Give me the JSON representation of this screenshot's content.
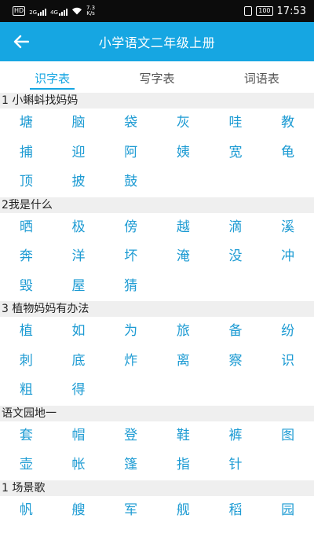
{
  "status_bar": {
    "hd_label": "HD",
    "sig1_label": "2G",
    "sig2_label": "4G",
    "net_speed_value": "7.3",
    "net_speed_unit": "K/s",
    "battery": "100",
    "time": "17:53"
  },
  "app_bar": {
    "title": "小学语文二年级上册",
    "back_icon": "arrow-left-icon"
  },
  "tabs": [
    {
      "label": "识字表",
      "active": true
    },
    {
      "label": "写字表",
      "active": false
    },
    {
      "label": "词语表",
      "active": false
    }
  ],
  "colors": {
    "accent": "#16a6e2",
    "char_text": "#1d9bd3",
    "section_bg": "#efefef"
  },
  "sections": [
    {
      "title": "1 小蝌蚪找妈妈",
      "chars": [
        "塘",
        "脑",
        "袋",
        "灰",
        "哇",
        "教",
        "捕",
        "迎",
        "阿",
        "姨",
        "宽",
        "龟",
        "顶",
        "披",
        "鼓"
      ]
    },
    {
      "title": "2我是什么",
      "chars": [
        "晒",
        "极",
        "傍",
        "越",
        "滴",
        "溪",
        "奔",
        "洋",
        "坏",
        "淹",
        "没",
        "冲",
        "毁",
        "屋",
        "猜"
      ]
    },
    {
      "title": "3 植物妈妈有办法",
      "chars": [
        "植",
        "如",
        "为",
        "旅",
        "备",
        "纷",
        "刺",
        "底",
        "炸",
        "离",
        "察",
        "识",
        "粗",
        "得"
      ]
    },
    {
      "title": "语文园地一",
      "chars": [
        "套",
        "帽",
        "登",
        "鞋",
        "裤",
        "图",
        "壶",
        "帐",
        "篷",
        "指",
        "针"
      ]
    },
    {
      "title": "1 场景歌",
      "chars": [
        "帆",
        "艘",
        "军",
        "舰",
        "稻",
        "园"
      ]
    }
  ]
}
